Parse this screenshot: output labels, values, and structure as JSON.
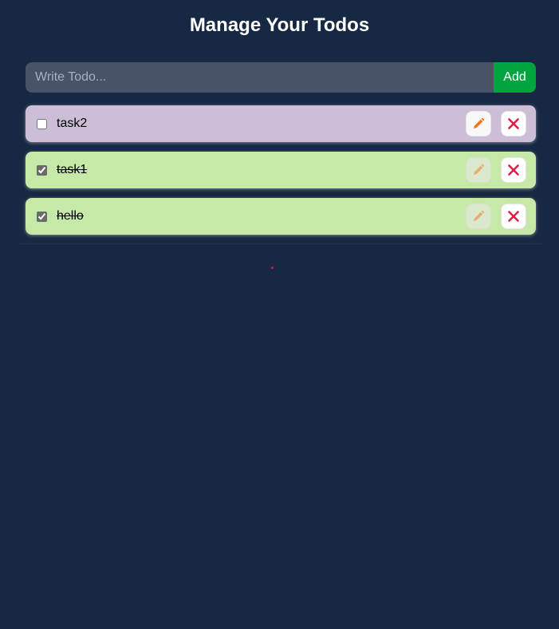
{
  "header": {
    "title": "Manage Your Todos"
  },
  "input": {
    "placeholder": "Write Todo...",
    "value": "",
    "add_label": "Add"
  },
  "todos": [
    {
      "text": "task2",
      "completed": false
    },
    {
      "text": "task1",
      "completed": true
    },
    {
      "text": "hello",
      "completed": true
    }
  ],
  "colors": {
    "background": "#172842",
    "pending_item": "#ccbed7",
    "completed_item": "#c6e9a7",
    "add_button": "#00a53f",
    "input_background": "#465369",
    "edit_icon": "#f97316",
    "delete_icon": "#e11d48"
  },
  "icons": {
    "edit": "pencil-icon",
    "delete": "close-icon"
  }
}
